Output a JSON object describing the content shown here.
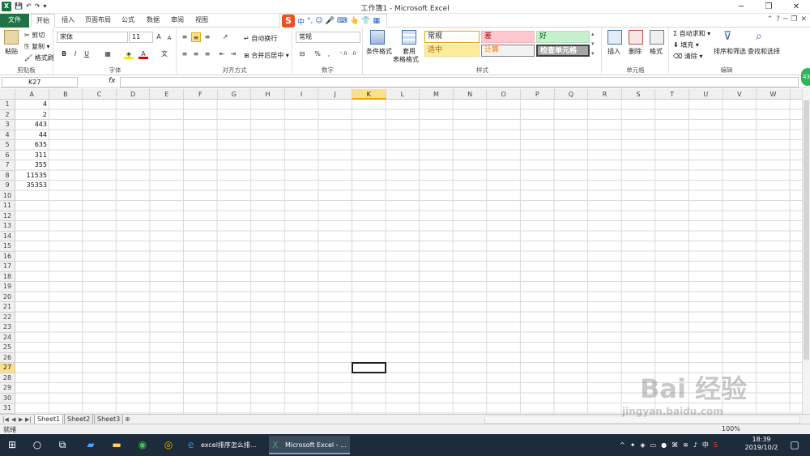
{
  "window": {
    "title": "工作簿1 - Microsoft Excel",
    "qat_undo": "↶",
    "qat_redo": "↷"
  },
  "tabs": [
    "文件",
    "开始",
    "插入",
    "页面布局",
    "公式",
    "数据",
    "审阅",
    "视图"
  ],
  "ime": {
    "labels": [
      "中",
      "°,",
      "☺",
      "🎤",
      "⌨",
      "👆",
      "👕",
      "▦"
    ]
  },
  "ribbon": {
    "clipboard": {
      "label": "剪贴板",
      "paste": "粘贴",
      "cut": "剪切",
      "copy": "复制",
      "format_painter": "格式刷"
    },
    "font": {
      "label": "字体",
      "font_name": "宋体",
      "font_size": "11",
      "bold": "B",
      "italic": "I",
      "underline": "U",
      "grow": "A",
      "shrink": "A",
      "color_a": "A"
    },
    "alignment": {
      "label": "对齐方式",
      "wrap": "自动换行",
      "merge": "合并后居中"
    },
    "number": {
      "label": "数字",
      "format": "常规",
      "percent": "%",
      "comma": ","
    },
    "styles": {
      "label": "样式",
      "conditional": "条件格式",
      "table": "套用",
      "table2": "表格格式",
      "normal": "常规",
      "bad": "差",
      "good": "好",
      "neutral": "适中",
      "calc": "计算",
      "check": "检查单元格"
    },
    "cells": {
      "label": "单元格",
      "insert": "插入",
      "delete": "删除",
      "format": "格式"
    },
    "editing": {
      "label": "编辑",
      "autosum": "自动求和",
      "fill": "填充",
      "clear": "清除",
      "sort": "排序和筛选",
      "find": "查找和选择",
      "sigma": "Σ"
    }
  },
  "formula_bar": {
    "name_box": "K27",
    "fx": "fx",
    "value": ""
  },
  "columns": [
    "A",
    "B",
    "C",
    "D",
    "E",
    "F",
    "G",
    "H",
    "I",
    "J",
    "K",
    "L",
    "M",
    "N",
    "O",
    "P",
    "Q",
    "R",
    "S",
    "T",
    "U",
    "V",
    "W"
  ],
  "selected_column": "K",
  "rows": [
    "1",
    "2",
    "3",
    "4",
    "5",
    "6",
    "7",
    "8",
    "9",
    "10",
    "11",
    "12",
    "13",
    "14",
    "15",
    "16",
    "17",
    "18",
    "19",
    "20",
    "21",
    "22",
    "23",
    "24",
    "25",
    "26",
    "27",
    "28",
    "29",
    "30",
    "31"
  ],
  "selected_row": "27",
  "column_a_values": [
    "4",
    "2",
    "443",
    "44",
    "635",
    "311",
    "355",
    "11535",
    "35353"
  ],
  "sheets": [
    "Sheet1",
    "Sheet2",
    "Sheet3"
  ],
  "status": {
    "ready": "就绪",
    "zoom": "100%"
  },
  "taskbar": {
    "app1": "excel排序怎么排...",
    "app2": "Microsoft Excel - ...",
    "time": "18:39",
    "date": "2019/10/2",
    "ime": "中"
  },
  "side_badge": "43",
  "watermark": {
    "line1": "Bai 经验",
    "line2": "jingyan.baidu.com"
  },
  "colors": {
    "excel_green": "#1f7244",
    "selection_yellow": "#fbe08b",
    "bad_fill": "#ffc7ce",
    "good_fill": "#c6efce",
    "neutral_fill": "#ffeb9c",
    "check_fill": "#a5a5a5"
  }
}
